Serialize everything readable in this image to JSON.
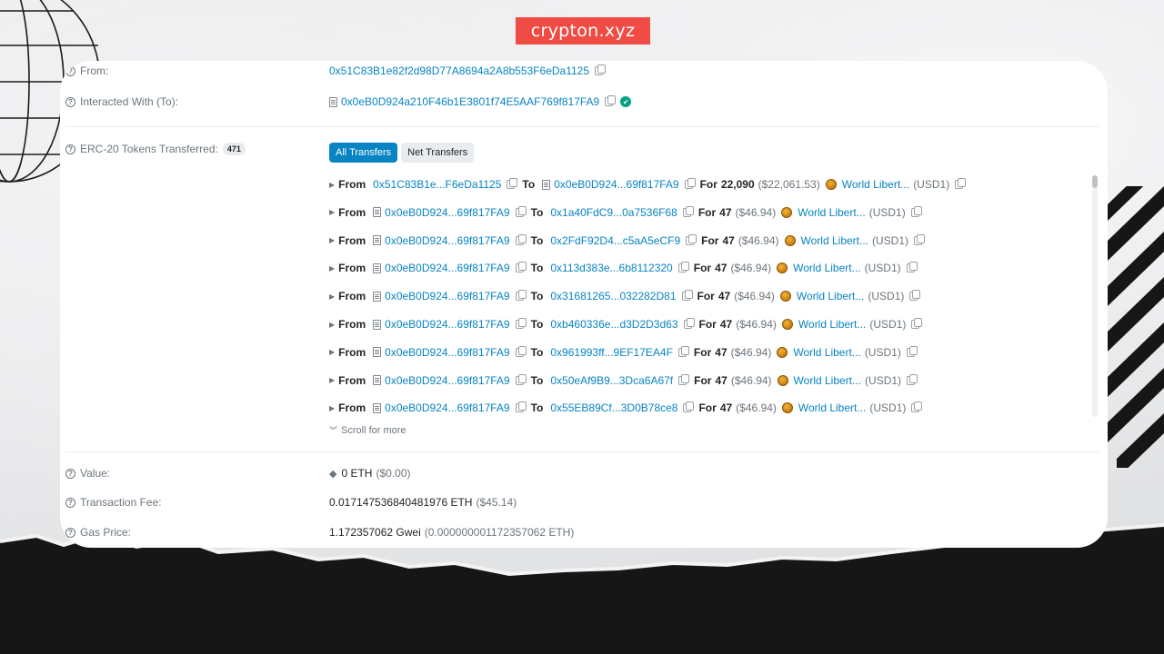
{
  "brand": {
    "label": "crypton.xyz",
    "color": "#f04b45"
  },
  "colors": {
    "link": "#0784c3",
    "muted": "#6c757d",
    "verified": "#00a186"
  },
  "from": {
    "label": "From:",
    "address": "0x51C83B1e82f2d98D77A8694a2A8b553F6eDa1125"
  },
  "interacted": {
    "label": "Interacted With (To):",
    "address": "0x0eB0D924a210F46b1E3801f74E5AAF769f817FA9"
  },
  "erc20": {
    "label": "ERC-20 Tokens Transferred:",
    "count": "471",
    "tabs": {
      "all": "All Transfers",
      "net": "Net Transfers"
    },
    "from_word": "From",
    "to_word": "To",
    "for_word": "For",
    "scroll_more": "Scroll for more",
    "transfers": [
      {
        "from": "0x51C83B1e...F6eDa1125",
        "to": "0x0eB0D924...69f817FA9",
        "amount": "22,090",
        "usd": "($22,061.53)",
        "token": "World Libert...",
        "symbol": "(USD1)"
      },
      {
        "from": "0x0eB0D924...69f817FA9",
        "to": "0x1a40FdC9...0a7536F68",
        "amount": "47",
        "usd": "($46.94)",
        "token": "World Libert...",
        "symbol": "(USD1)"
      },
      {
        "from": "0x0eB0D924...69f817FA9",
        "to": "0x2FdF92D4...c5aA5eCF9",
        "amount": "47",
        "usd": "($46.94)",
        "token": "World Libert...",
        "symbol": "(USD1)"
      },
      {
        "from": "0x0eB0D924...69f817FA9",
        "to": "0x113d383e...6b8112320",
        "amount": "47",
        "usd": "($46.94)",
        "token": "World Libert...",
        "symbol": "(USD1)"
      },
      {
        "from": "0x0eB0D924...69f817FA9",
        "to": "0x31681265...032282D81",
        "amount": "47",
        "usd": "($46.94)",
        "token": "World Libert...",
        "symbol": "(USD1)"
      },
      {
        "from": "0x0eB0D924...69f817FA9",
        "to": "0xb460336e...d3D2D3d63",
        "amount": "47",
        "usd": "($46.94)",
        "token": "World Libert...",
        "symbol": "(USD1)"
      },
      {
        "from": "0x0eB0D924...69f817FA9",
        "to": "0x961993ff...9EF17EA4F",
        "amount": "47",
        "usd": "($46.94)",
        "token": "World Libert...",
        "symbol": "(USD1)"
      },
      {
        "from": "0x0eB0D924...69f817FA9",
        "to": "0x50eAf9B9...3Dca6A67f",
        "amount": "47",
        "usd": "($46.94)",
        "token": "World Libert...",
        "symbol": "(USD1)"
      },
      {
        "from": "0x0eB0D924...69f817FA9",
        "to": "0x55EB89Cf...3D0B78ce8",
        "amount": "47",
        "usd": "($46.94)",
        "token": "World Libert...",
        "symbol": "(USD1)"
      }
    ]
  },
  "value": {
    "label": "Value:",
    "amount": "0 ETH",
    "usd": "($0.00)"
  },
  "fee": {
    "label": "Transaction Fee:",
    "amount": "0.017147536840481976 ETH",
    "usd": "($45.14)"
  },
  "gas": {
    "label": "Gas Price:",
    "amount": "1.172357062 Gwei",
    "eth": "(0.000000001172357062 ETH)"
  }
}
